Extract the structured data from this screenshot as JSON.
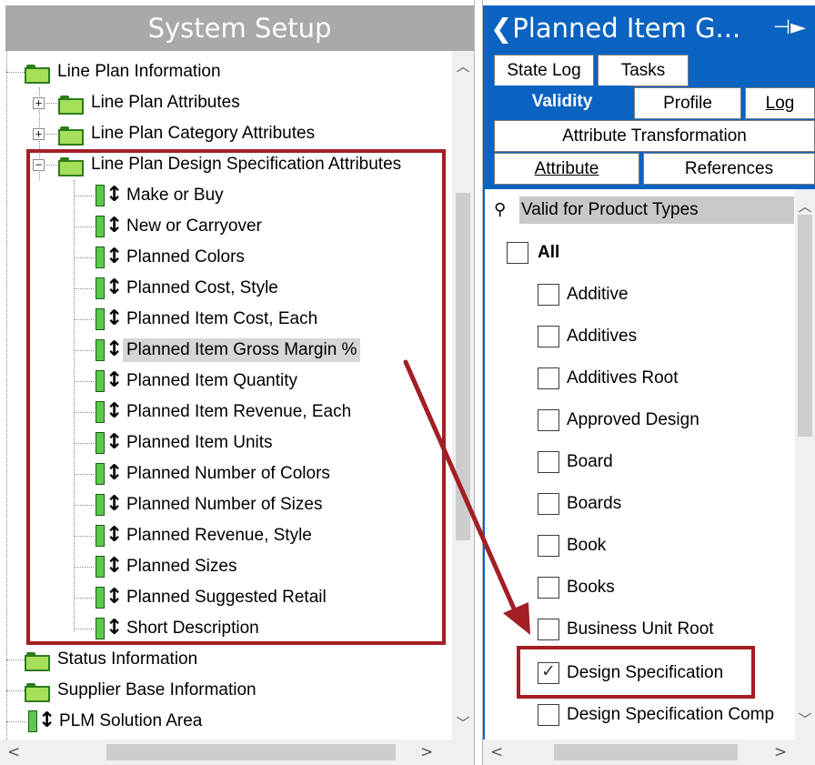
{
  "left_panel": {
    "title": "System Setup",
    "tree": [
      {
        "label": "Line Plan Information",
        "type": "folder"
      },
      {
        "label": "Line Plan Attributes",
        "type": "folder"
      },
      {
        "label": "Line Plan Category Attributes",
        "type": "folder"
      },
      {
        "label": "Line Plan Design Specification Attributes",
        "type": "folder"
      },
      {
        "label": "Make or Buy",
        "type": "attribute"
      },
      {
        "label": "New or Carryover",
        "type": "attribute"
      },
      {
        "label": "Planned Colors",
        "type": "attribute"
      },
      {
        "label": "Planned Cost, Style",
        "type": "attribute"
      },
      {
        "label": "Planned Item Cost, Each",
        "type": "attribute"
      },
      {
        "label": "Planned Item Gross Margin %",
        "type": "attribute",
        "selected": true
      },
      {
        "label": "Planned Item Quantity",
        "type": "attribute"
      },
      {
        "label": "Planned Item Revenue, Each",
        "type": "attribute"
      },
      {
        "label": "Planned Item Units",
        "type": "attribute"
      },
      {
        "label": "Planned Number of Colors",
        "type": "attribute"
      },
      {
        "label": "Planned Number of Sizes",
        "type": "attribute"
      },
      {
        "label": "Planned Revenue, Style",
        "type": "attribute"
      },
      {
        "label": "Planned Sizes",
        "type": "attribute"
      },
      {
        "label": "Planned Suggested Retail",
        "type": "attribute"
      },
      {
        "label": "Short Description",
        "type": "attribute"
      },
      {
        "label": "Status Information",
        "type": "folder"
      },
      {
        "label": "Supplier Base Information",
        "type": "folder"
      },
      {
        "label": "PLM Solution Area",
        "type": "attribute"
      }
    ]
  },
  "right_panel": {
    "title": "❮Planned Item G...",
    "pin_icon": "⊣►",
    "tabs": {
      "state_log": "State Log",
      "tasks": "Tasks",
      "validity": "Validity",
      "profile": "Profile",
      "log": "Log",
      "attribute_transformation": "Attribute Transformation",
      "attribute": "Attribute",
      "references": "References"
    },
    "section_title": "Valid for Product Types",
    "all_label": "All",
    "items": [
      {
        "label": "Additive",
        "checked": false
      },
      {
        "label": "Additives",
        "checked": false
      },
      {
        "label": "Additives Root",
        "checked": false
      },
      {
        "label": "Approved Design",
        "checked": false
      },
      {
        "label": "Board",
        "checked": false
      },
      {
        "label": "Boards",
        "checked": false
      },
      {
        "label": "Book",
        "checked": false
      },
      {
        "label": "Books",
        "checked": false
      },
      {
        "label": "Business Unit Root",
        "checked": false
      },
      {
        "label": "Design Specification",
        "checked": true
      },
      {
        "label": "Design Specification Comp",
        "checked": false
      }
    ]
  },
  "colors": {
    "header_gray": "#a9a9a9",
    "header_blue": "#0b63c1",
    "highlight_red": "#a31f25",
    "selection_gray": "#d6d6d6"
  }
}
